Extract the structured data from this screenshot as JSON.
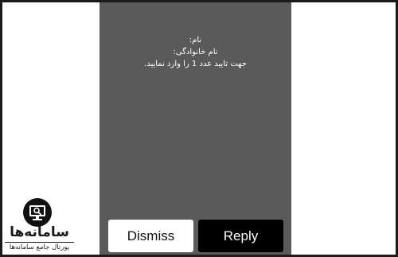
{
  "message": {
    "lines": [
      "نام:",
      "نام خانوادگی:",
      "جهت تایید عدد 1 را وارد نمایید."
    ]
  },
  "actions": {
    "dismiss_label": "Dismiss",
    "reply_label": "Reply"
  },
  "watermark": {
    "name": "سامانه‌ها",
    "tagline": "پورتال جامع سامانه‌ها",
    "icon": "monitor-search-icon"
  },
  "colors": {
    "screen_background": "#5a5a5a",
    "reply_button": "#000000",
    "dismiss_button": "#ffffff",
    "page_background": "#ffffff"
  }
}
